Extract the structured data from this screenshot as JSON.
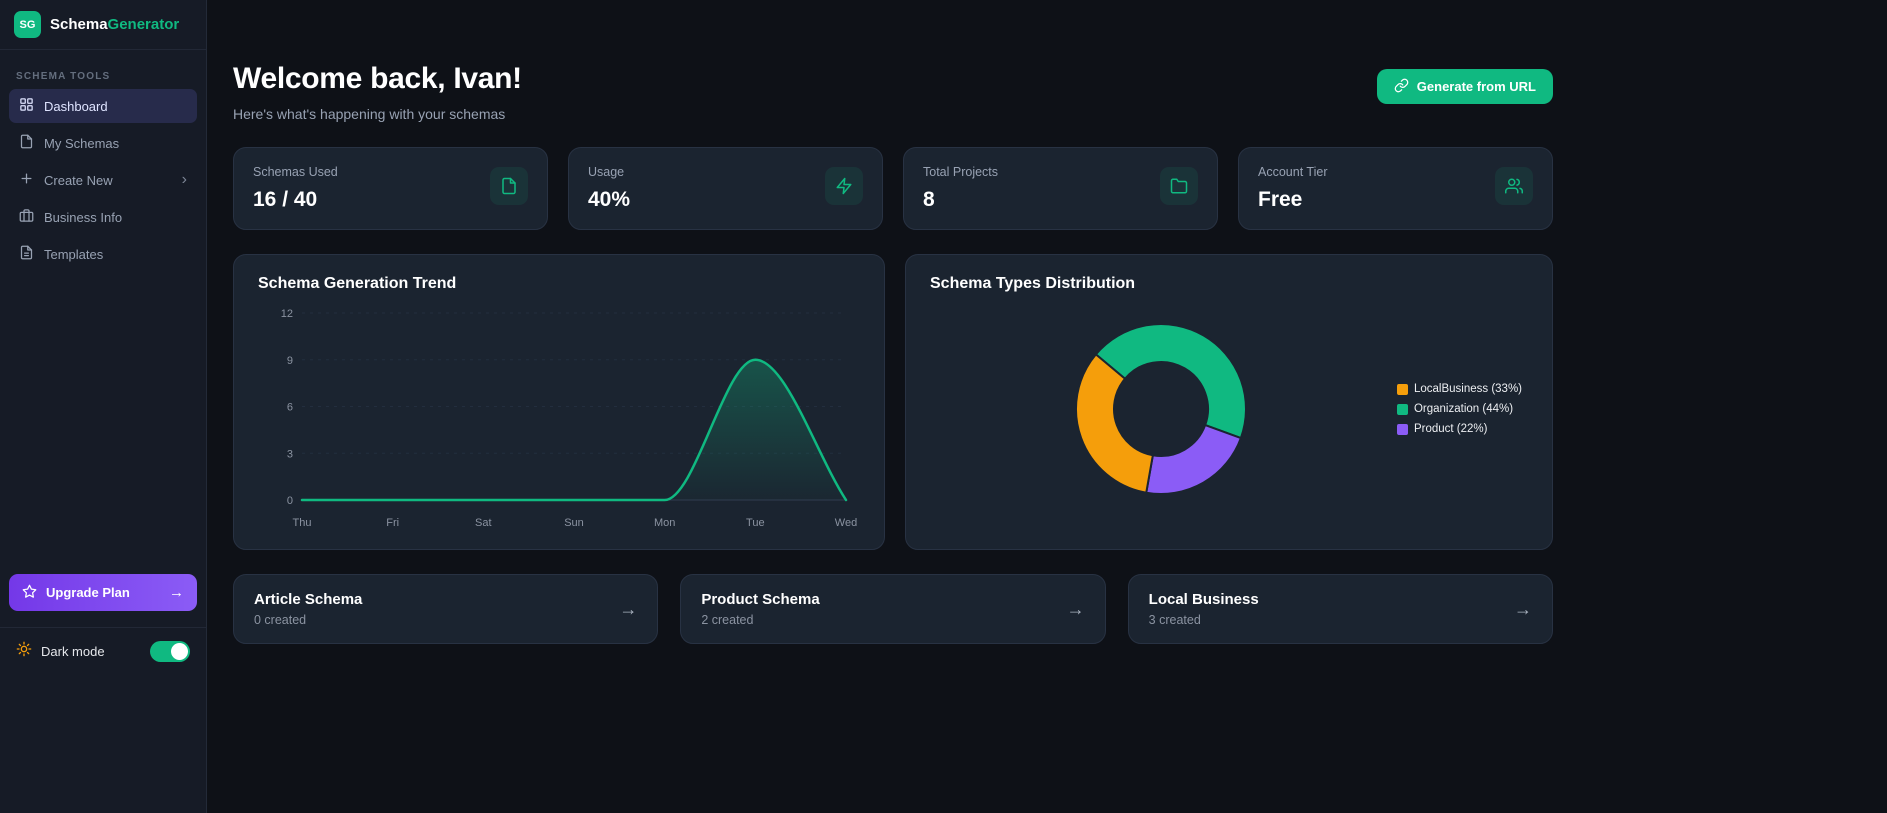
{
  "app": {
    "logo_initials": "SG",
    "name_part1": "Schema",
    "name_part2": "Generator"
  },
  "icons": {
    "arrow_right": "→",
    "chevron_right": "›"
  },
  "colors": {
    "accent_green": "#10b981",
    "accent_purple": "#8b5cf6",
    "orange": "#f59e0b",
    "card_bg": "#1b2430"
  },
  "sidebar": {
    "section_label": "SCHEMA TOOLS",
    "nav": [
      {
        "label": "Dashboard",
        "icon": "grid-icon",
        "active": true
      },
      {
        "label": "My Schemas",
        "icon": "file-icon",
        "active": false
      },
      {
        "label": "Create New",
        "icon": "plus-icon",
        "active": false,
        "has_chevron": true
      },
      {
        "label": "Business Info",
        "icon": "briefcase-icon",
        "active": false
      },
      {
        "label": "Templates",
        "icon": "file-text-icon",
        "active": false
      }
    ],
    "upgrade": {
      "label": "Upgrade Plan"
    },
    "dark_mode": {
      "label": "Dark mode",
      "enabled": true
    }
  },
  "header": {
    "title": "Welcome back, Ivan!",
    "subtitle": "Here's what's happening with your schemas",
    "generate_button": "Generate from URL"
  },
  "stats": [
    {
      "label": "Schemas Used",
      "value": "16 / 40",
      "icon": "file-icon"
    },
    {
      "label": "Usage",
      "value": "40%",
      "icon": "bolt-icon"
    },
    {
      "label": "Total Projects",
      "value": "8",
      "icon": "folder-icon"
    },
    {
      "label": "Account Tier",
      "value": "Free",
      "icon": "users-icon"
    }
  ],
  "chart_data": [
    {
      "type": "area",
      "title": "Schema Generation Trend",
      "x": [
        "Thu",
        "Fri",
        "Sat",
        "Sun",
        "Mon",
        "Tue",
        "Wed"
      ],
      "values": [
        0,
        0,
        0,
        0,
        0,
        9,
        0
      ],
      "ylim": [
        0,
        12
      ],
      "yticks": [
        0,
        3,
        6,
        9,
        12
      ],
      "grid": true,
      "line_color": "#10b981",
      "xlabel": "",
      "ylabel": ""
    },
    {
      "type": "pie",
      "donut": true,
      "title": "Schema Types Distribution",
      "legend_position": "right",
      "start_angle": -50,
      "render_order": [
        1,
        2,
        0
      ],
      "slices": [
        {
          "label": "LocalBusiness (33%)",
          "value": 33,
          "color": "#f59e0b"
        },
        {
          "label": "Organization (44%)",
          "value": 44,
          "color": "#10b981"
        },
        {
          "label": "Product (22%)",
          "value": 22,
          "color": "#8b5cf6"
        }
      ]
    }
  ],
  "quick_cards": [
    {
      "title": "Article Schema",
      "subtitle": "0 created"
    },
    {
      "title": "Product Schema",
      "subtitle": "2 created"
    },
    {
      "title": "Local Business",
      "subtitle": "3 created"
    }
  ]
}
